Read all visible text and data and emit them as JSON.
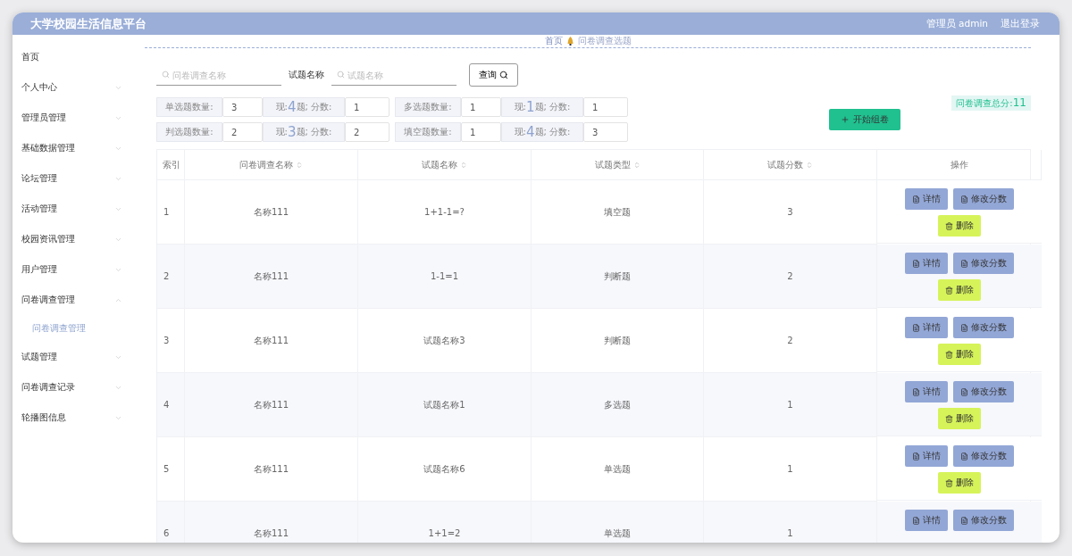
{
  "header": {
    "title": "大学校园生活信息平台",
    "user": "管理员 admin",
    "logout": "退出登录"
  },
  "sidebar": {
    "items": [
      {
        "label": "首页",
        "kind": "link"
      },
      {
        "label": "个人中心",
        "kind": "menu",
        "expanded": false
      },
      {
        "label": "管理员管理",
        "kind": "menu",
        "expanded": false
      },
      {
        "label": "基础数据管理",
        "kind": "menu",
        "expanded": false
      },
      {
        "label": "论坛管理",
        "kind": "menu",
        "expanded": false
      },
      {
        "label": "活动管理",
        "kind": "menu",
        "expanded": false
      },
      {
        "label": "校园资讯管理",
        "kind": "menu",
        "expanded": false
      },
      {
        "label": "用户管理",
        "kind": "menu",
        "expanded": false
      },
      {
        "label": "问卷调查管理",
        "kind": "menu",
        "expanded": true,
        "children": [
          {
            "label": "问卷调查管理",
            "selected": true
          }
        ]
      },
      {
        "label": "试题管理",
        "kind": "menu",
        "expanded": false
      },
      {
        "label": "问卷调查记录",
        "kind": "menu",
        "expanded": false
      },
      {
        "label": "轮播图信息",
        "kind": "menu",
        "expanded": false
      }
    ]
  },
  "breadcrumb": [
    "首页",
    "问卷调查选题"
  ],
  "search": {
    "fields": [
      {
        "placeholder": "问卷调查名称"
      },
      {
        "label": "试题名称",
        "placeholder": "试题名称"
      }
    ],
    "button": "查询"
  },
  "stats": [
    {
      "label": "单选题数量:",
      "count": "3",
      "now_prefix": "现:",
      "now": "4",
      "now_suffix": "题; 分数:",
      "score": "1"
    },
    {
      "label": "多选题数量:",
      "count": "1",
      "now_prefix": "现:",
      "now": "1",
      "now_suffix": "题; 分数:",
      "score": "1"
    },
    {
      "label": "判选题数量:",
      "count": "2",
      "now_prefix": "现:",
      "now": "3",
      "now_suffix": "题; 分数:",
      "score": "2"
    },
    {
      "label": "填空题数量:",
      "count": "1",
      "now_prefix": "现:",
      "now": "4",
      "now_suffix": "题; 分数:",
      "score": "3"
    }
  ],
  "compose_button": "开始组卷",
  "total": {
    "label": "问卷调查总分:",
    "value": "11"
  },
  "table": {
    "columns": [
      {
        "label": "索引",
        "sortable": false
      },
      {
        "label": "问卷调查名称",
        "sortable": true
      },
      {
        "label": "试题名称",
        "sortable": true
      },
      {
        "label": "试题类型",
        "sortable": true
      },
      {
        "label": "试题分数",
        "sortable": true
      },
      {
        "label": "操作",
        "sortable": false
      }
    ],
    "rows": [
      {
        "index": "1",
        "survey": "名称111",
        "question": "1+1-1=?",
        "type": "填空题",
        "score": "3",
        "actions": [
          "详情",
          "修改分数",
          "删除"
        ]
      },
      {
        "index": "2",
        "survey": "名称111",
        "question": "1-1=1",
        "type": "判断题",
        "score": "2",
        "actions": [
          "详情",
          "修改分数",
          "删除"
        ]
      },
      {
        "index": "3",
        "survey": "名称111",
        "question": "试题名称3",
        "type": "判断题",
        "score": "2",
        "actions": [
          "详情",
          "修改分数",
          "删除"
        ]
      },
      {
        "index": "4",
        "survey": "名称111",
        "question": "试题名称1",
        "type": "多选题",
        "score": "1",
        "actions": [
          "详情",
          "修改分数",
          "删除"
        ]
      },
      {
        "index": "5",
        "survey": "名称111",
        "question": "试题名称6",
        "type": "单选题",
        "score": "1",
        "actions": [
          "详情",
          "修改分数",
          "删除"
        ]
      },
      {
        "index": "6",
        "survey": "名称111",
        "question": "1+1=2",
        "type": "单选题",
        "score": "1",
        "actions": [
          "详情",
          "修改分数"
        ]
      }
    ]
  }
}
